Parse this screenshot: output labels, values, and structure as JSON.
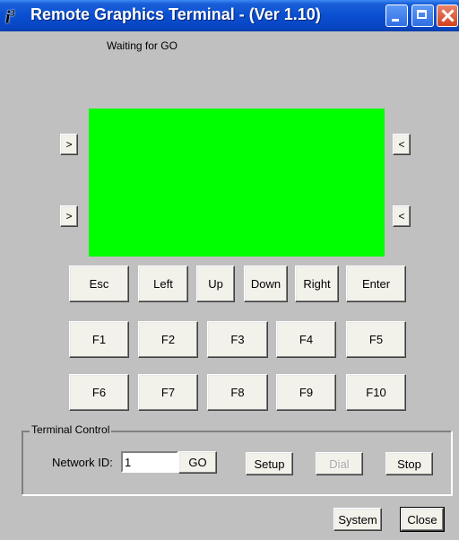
{
  "window": {
    "title": "Remote Graphics Terminal - (Ver 1.10)",
    "icon_glyph": "i",
    "icon_sup": "3"
  },
  "status_text": "Waiting for GO",
  "display": {
    "color": "#00ff00"
  },
  "side_buttons": {
    "left_top": ">",
    "left_bottom": ">",
    "right_top": "<",
    "right_bottom": "<"
  },
  "nav_keys": [
    "Esc",
    "Left",
    "Up",
    "Down",
    "Right",
    "Enter"
  ],
  "function_keys_row1": [
    "F1",
    "F2",
    "F3",
    "F4",
    "F5"
  ],
  "function_keys_row2": [
    "F6",
    "F7",
    "F8",
    "F9",
    "F10"
  ],
  "terminal_control": {
    "label": "Terminal Control",
    "network_id_label": "Network ID:",
    "network_id_value": "1",
    "go_label": "GO",
    "setup_label": "Setup",
    "dial_label": "Dial",
    "stop_label": "Stop"
  },
  "bottom": {
    "system_label": "System",
    "close_label": "Close"
  }
}
